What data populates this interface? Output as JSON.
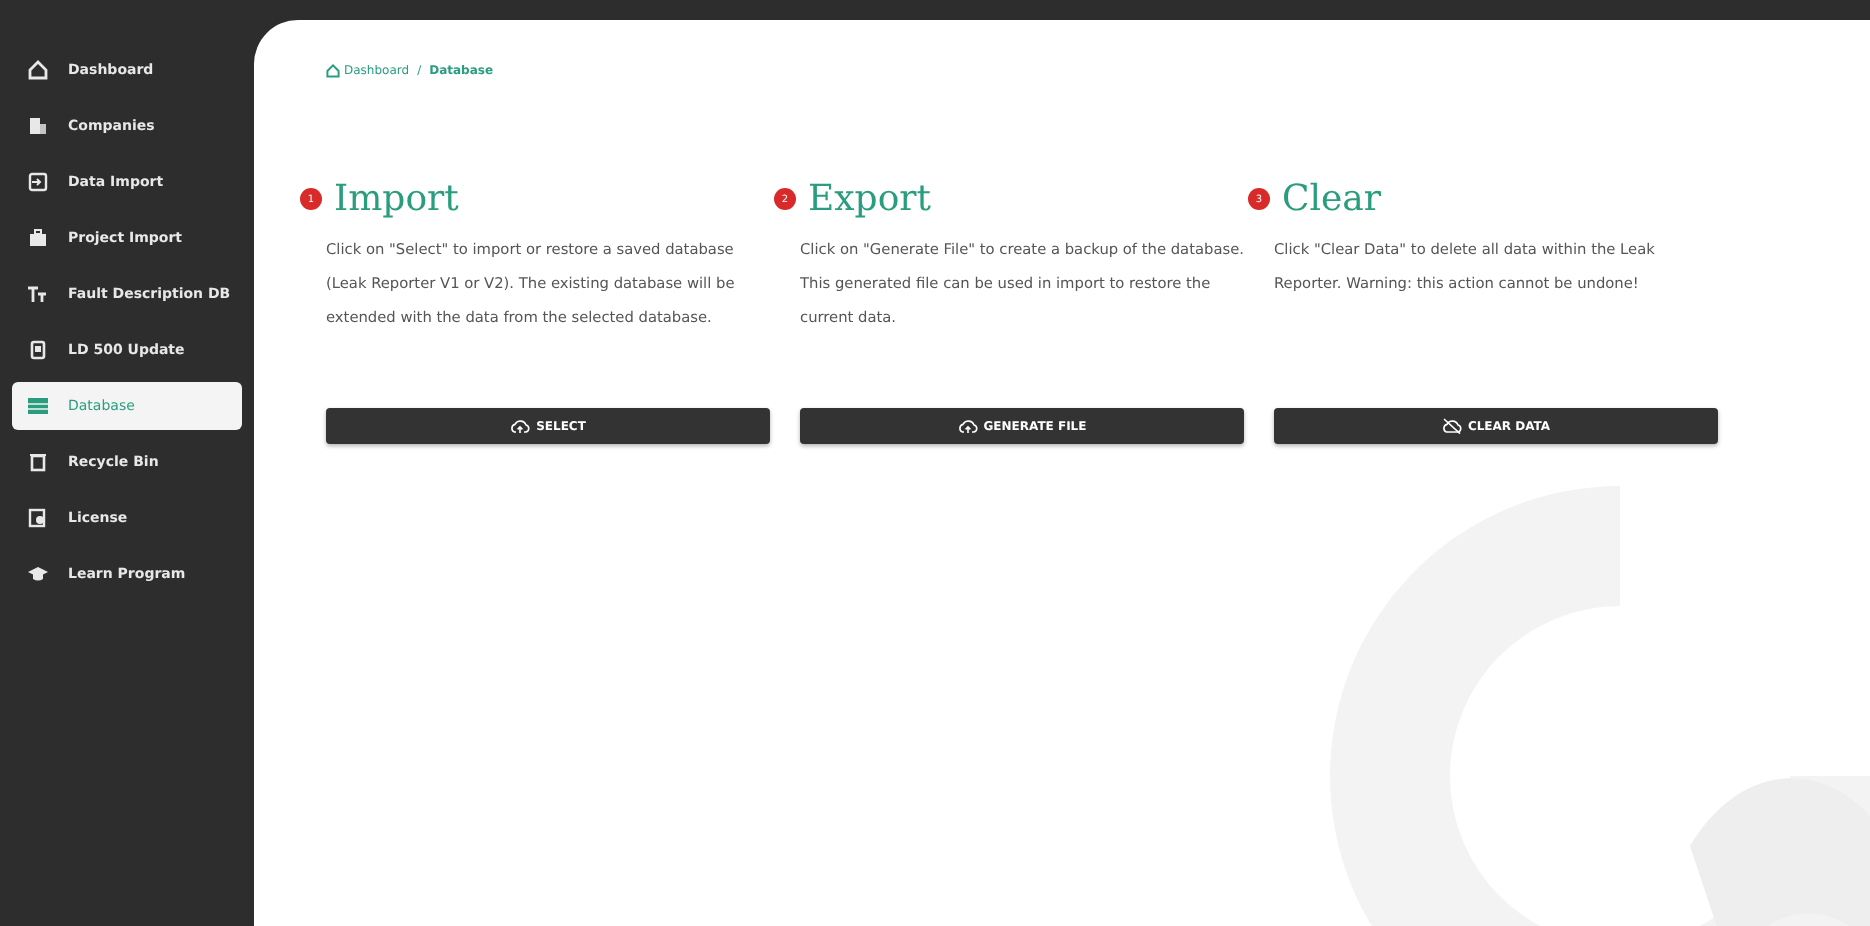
{
  "sidebar": {
    "items": [
      {
        "label": "Dashboard",
        "selected": false
      },
      {
        "label": "Companies",
        "selected": false
      },
      {
        "label": "Data Import",
        "selected": false
      },
      {
        "label": "Project Import",
        "selected": false
      },
      {
        "label": "Fault Description DB",
        "selected": false
      },
      {
        "label": "LD 500 Update",
        "selected": false
      },
      {
        "label": "Database",
        "selected": true
      },
      {
        "label": "Recycle Bin",
        "selected": false
      },
      {
        "label": "License",
        "selected": false
      },
      {
        "label": "Learn Program",
        "selected": false
      }
    ]
  },
  "breadcrumb": {
    "items": [
      "Dashboard",
      "Database"
    ],
    "separator": "/"
  },
  "sections": [
    {
      "number": "1",
      "title": "Import",
      "description": "Click on \"Select\" to import or restore a saved database (Leak Reporter V1 or V2). The existing database will be extended with the data from the selected database.",
      "button": "SELECT"
    },
    {
      "number": "2",
      "title": "Export",
      "description": "Click on \"Generate File\" to create a backup of the database. This generated file can be used in import to restore the current data.",
      "button": "GENERATE FILE"
    },
    {
      "number": "3",
      "title": "Clear",
      "description": "Click \"Clear Data\" to delete all data within the Leak Reporter. Warning: this action cannot be undone!",
      "button": "CLEAR DATA"
    }
  ]
}
